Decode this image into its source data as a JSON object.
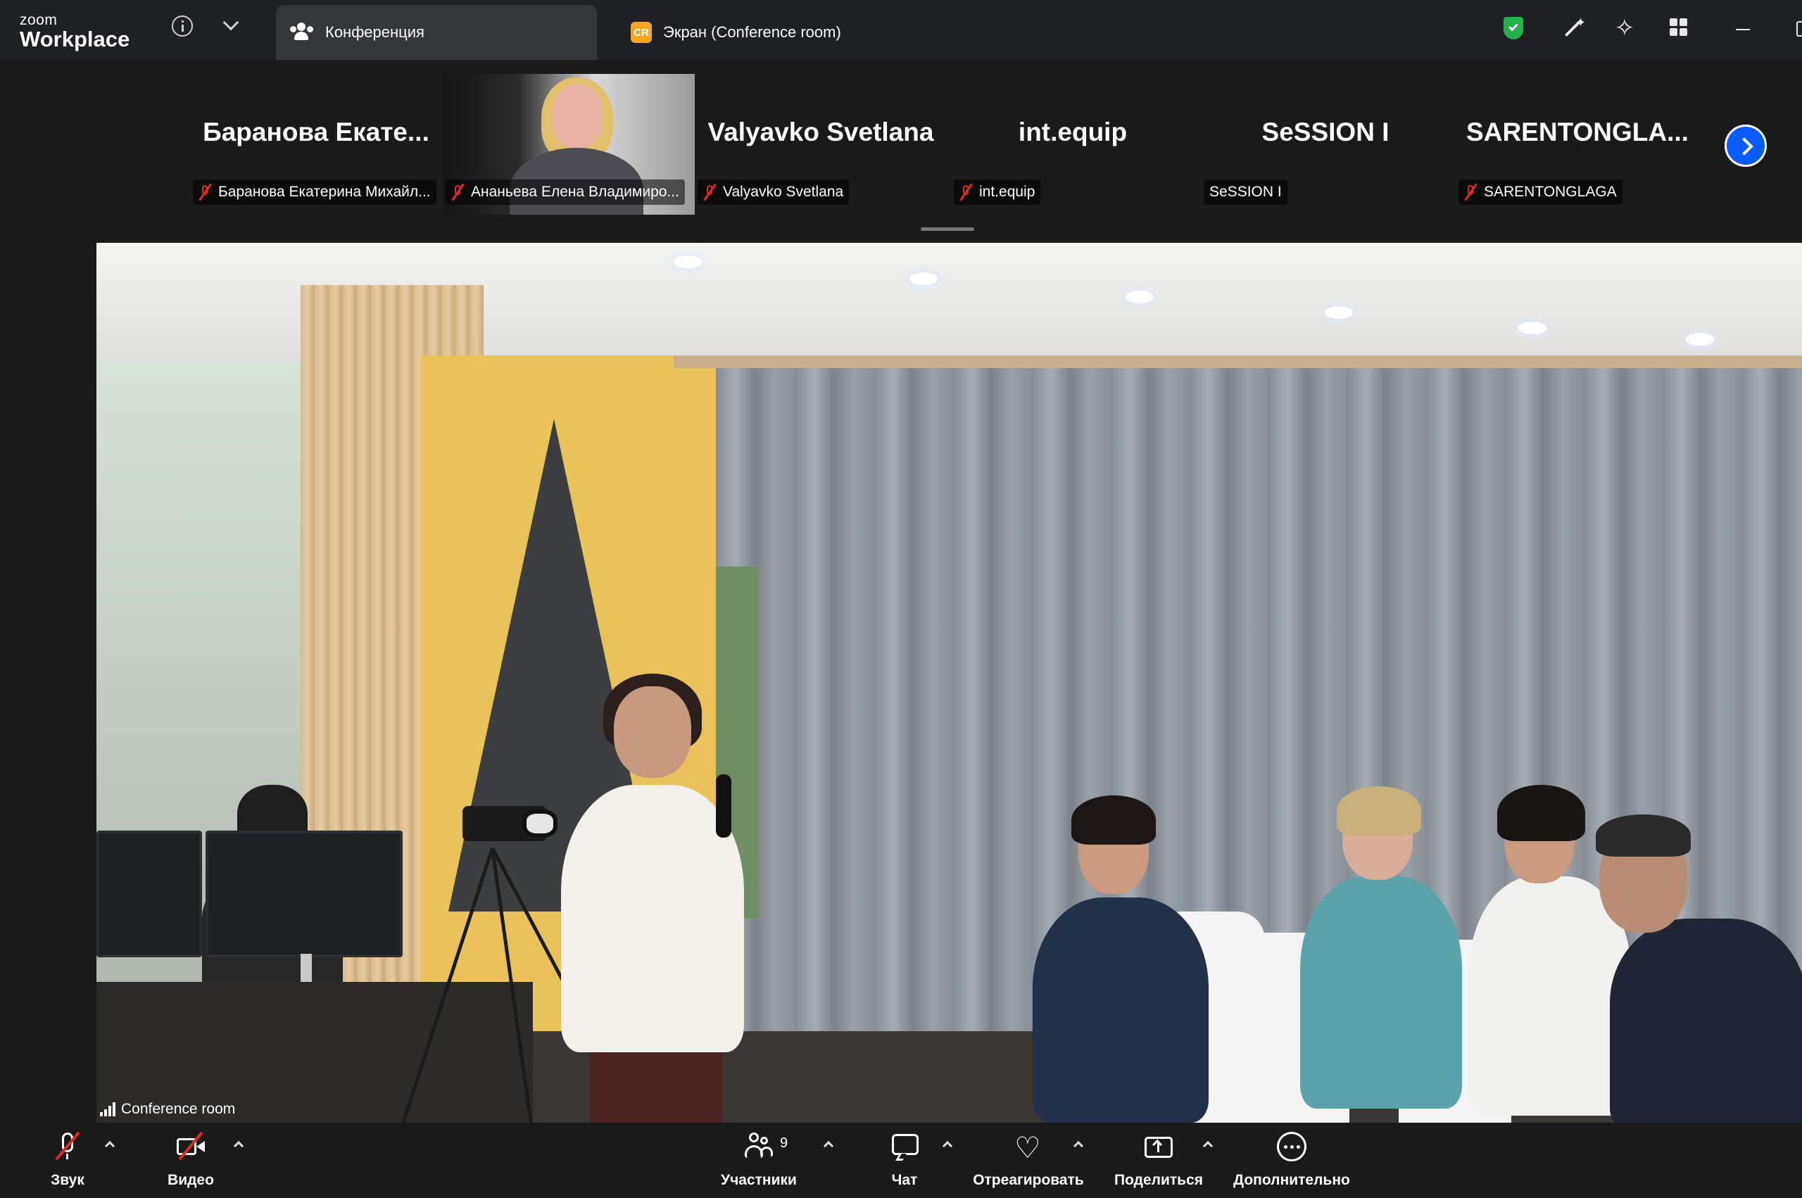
{
  "app": {
    "logo_small": "zoom",
    "logo_big": "Workplace"
  },
  "tabs": [
    {
      "label": "Конференция",
      "icon": "people-icon"
    },
    {
      "label": "Экран (Conference room)",
      "icon": "cr-badge",
      "badge": "CR"
    }
  ],
  "accent_colors": {
    "brand_blue": "#0b5cff",
    "muted_red": "#e02828",
    "secure_green": "#22b14c",
    "badge_orange": "#f5a623"
  },
  "gallery": {
    "tiles": [
      {
        "display_name": "Баранова  Екате...",
        "tag": "Баранова Екатерина Михайл...",
        "muted": true,
        "video": false
      },
      {
        "display_name": "",
        "tag": "Ананьева Елена Владимиро...",
        "muted": true,
        "video": true
      },
      {
        "display_name": "Valyavko Svetlana",
        "tag": "Valyavko Svetlana",
        "muted": true,
        "video": false
      },
      {
        "display_name": "int.equip",
        "tag": "int.equip",
        "muted": true,
        "video": false
      },
      {
        "display_name": "SeSSION I",
        "tag": "SeSSION I",
        "muted": false,
        "video": false
      },
      {
        "display_name": "SARENTONGLA...",
        "tag": "SARENTONGLAGA",
        "muted": true,
        "video": false
      }
    ]
  },
  "share": {
    "label": "Conference room"
  },
  "controls": {
    "audio": "Звук",
    "video": "Видео",
    "participants": "Участники",
    "participants_count": "9",
    "chat": "Чат",
    "react": "Отреагировать",
    "share": "Поделиться",
    "more": "Дополнительно"
  }
}
